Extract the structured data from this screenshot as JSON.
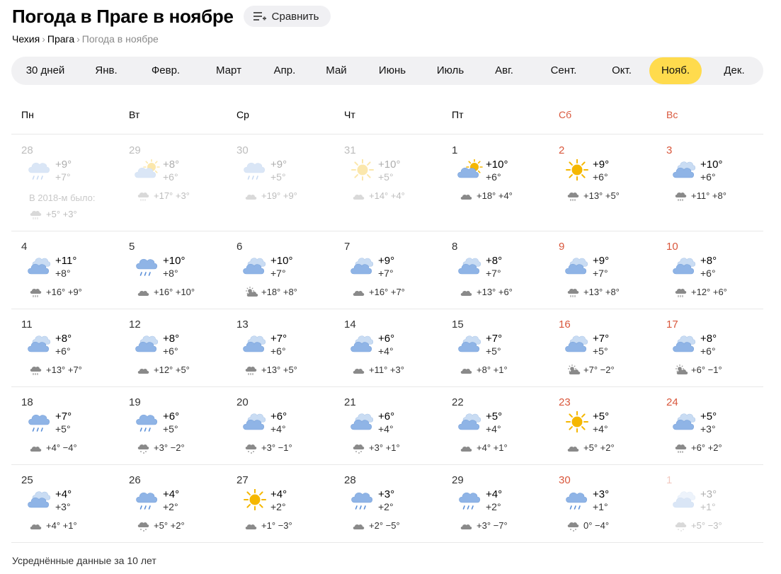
{
  "header": {
    "title": "Погода в Праге в ноябре",
    "compare_label": "Сравнить"
  },
  "breadcrumb": {
    "country": "Чехия",
    "city": "Прага",
    "current": "Погода в ноябре",
    "sep": "›"
  },
  "months": [
    {
      "label": "30 дней",
      "active": false
    },
    {
      "label": "Янв.",
      "active": false
    },
    {
      "label": "Февр.",
      "active": false
    },
    {
      "label": "Март",
      "active": false
    },
    {
      "label": "Апр.",
      "active": false
    },
    {
      "label": "Май",
      "active": false
    },
    {
      "label": "Июнь",
      "active": false
    },
    {
      "label": "Июль",
      "active": false
    },
    {
      "label": "Авг.",
      "active": false
    },
    {
      "label": "Сент.",
      "active": false
    },
    {
      "label": "Окт.",
      "active": false
    },
    {
      "label": "Нояб.",
      "active": true
    },
    {
      "label": "Дек.",
      "active": false
    }
  ],
  "weekdays": [
    {
      "label": "Пн",
      "weekend": false
    },
    {
      "label": "Вт",
      "weekend": false
    },
    {
      "label": "Ср",
      "weekend": false
    },
    {
      "label": "Чт",
      "weekend": false
    },
    {
      "label": "Пт",
      "weekend": false
    },
    {
      "label": "Сб",
      "weekend": true
    },
    {
      "label": "Вс",
      "weekend": true
    }
  ],
  "colors": {
    "accent": "#ffdb4d",
    "weekend": "#d9573c",
    "cloud": "#8fb4e6",
    "sun": "#f5b700",
    "rain": "#5a8fd8",
    "hist_cloud": "#8a8a8a"
  },
  "weeks": [
    [
      {
        "day": "28",
        "weekend": false,
        "faded": true,
        "icon": "rain-cloud-icon",
        "max": "+9°",
        "min": "+7°",
        "note": "В 2018-м было:",
        "hist_icon": "hist-rain-icon",
        "hist": "+5° +3°"
      },
      {
        "day": "29",
        "weekend": false,
        "faded": true,
        "icon": "sun-cloud-icon",
        "max": "+8°",
        "min": "+6°",
        "hist_icon": "hist-rain-icon",
        "hist": "+17° +3°"
      },
      {
        "day": "30",
        "weekend": false,
        "faded": true,
        "icon": "rain-cloud-icon",
        "max": "+9°",
        "min": "+5°",
        "hist_icon": "hist-cloud-icon",
        "hist": "+19° +9°"
      },
      {
        "day": "31",
        "weekend": false,
        "faded": true,
        "icon": "sun-icon",
        "max": "+10°",
        "min": "+5°",
        "hist_icon": "hist-cloud-icon",
        "hist": "+14° +4°"
      },
      {
        "day": "1",
        "weekend": false,
        "faded": false,
        "icon": "sun-cloud-icon",
        "max": "+10°",
        "min": "+6°",
        "hist_icon": "hist-cloud-icon",
        "hist": "+18° +4°"
      },
      {
        "day": "2",
        "weekend": true,
        "faded": false,
        "icon": "sun-icon",
        "max": "+9°",
        "min": "+6°",
        "hist_icon": "hist-rain-icon",
        "hist": "+13° +5°"
      },
      {
        "day": "3",
        "weekend": true,
        "faded": false,
        "icon": "cloud-icon",
        "max": "+10°",
        "min": "+6°",
        "hist_icon": "hist-rain-icon",
        "hist": "+11° +8°"
      }
    ],
    [
      {
        "day": "4",
        "weekend": false,
        "faded": false,
        "icon": "cloud-icon",
        "max": "+11°",
        "min": "+8°",
        "hist_icon": "hist-rain-icon",
        "hist": "+16° +9°"
      },
      {
        "day": "5",
        "weekend": false,
        "faded": false,
        "icon": "rain-cloud-icon",
        "max": "+10°",
        "min": "+8°",
        "hist_icon": "hist-cloud-icon",
        "hist": "+16° +10°"
      },
      {
        "day": "6",
        "weekend": false,
        "faded": false,
        "icon": "cloud-icon",
        "max": "+10°",
        "min": "+7°",
        "hist_icon": "hist-sun-cloud-icon",
        "hist": "+18° +8°"
      },
      {
        "day": "7",
        "weekend": false,
        "faded": false,
        "icon": "cloud-icon",
        "max": "+9°",
        "min": "+7°",
        "hist_icon": "hist-cloud-icon",
        "hist": "+16° +7°"
      },
      {
        "day": "8",
        "weekend": false,
        "faded": false,
        "icon": "cloud-icon",
        "max": "+8°",
        "min": "+7°",
        "hist_icon": "hist-cloud-icon",
        "hist": "+13° +6°"
      },
      {
        "day": "9",
        "weekend": true,
        "faded": false,
        "icon": "cloud-icon",
        "max": "+9°",
        "min": "+7°",
        "hist_icon": "hist-rain-icon",
        "hist": "+13° +8°"
      },
      {
        "day": "10",
        "weekend": true,
        "faded": false,
        "icon": "cloud-icon",
        "max": "+8°",
        "min": "+6°",
        "hist_icon": "hist-rain-icon",
        "hist": "+12° +6°"
      }
    ],
    [
      {
        "day": "11",
        "weekend": false,
        "faded": false,
        "icon": "cloud-icon",
        "max": "+8°",
        "min": "+6°",
        "hist_icon": "hist-rain-icon",
        "hist": "+13° +7°"
      },
      {
        "day": "12",
        "weekend": false,
        "faded": false,
        "icon": "cloud-icon",
        "max": "+8°",
        "min": "+6°",
        "hist_icon": "hist-cloud-icon",
        "hist": "+12° +5°"
      },
      {
        "day": "13",
        "weekend": false,
        "faded": false,
        "icon": "cloud-icon",
        "max": "+7°",
        "min": "+6°",
        "hist_icon": "hist-rain-icon",
        "hist": "+13° +5°"
      },
      {
        "day": "14",
        "weekend": false,
        "faded": false,
        "icon": "cloud-icon",
        "max": "+6°",
        "min": "+4°",
        "hist_icon": "hist-cloud-icon",
        "hist": "+11° +3°"
      },
      {
        "day": "15",
        "weekend": false,
        "faded": false,
        "icon": "cloud-icon",
        "max": "+7°",
        "min": "+5°",
        "hist_icon": "hist-cloud-icon",
        "hist": "+8° +1°"
      },
      {
        "day": "16",
        "weekend": true,
        "faded": false,
        "icon": "cloud-icon",
        "max": "+7°",
        "min": "+5°",
        "hist_icon": "hist-sun-cloud-icon",
        "hist": "+7° −2°"
      },
      {
        "day": "17",
        "weekend": true,
        "faded": false,
        "icon": "cloud-icon",
        "max": "+8°",
        "min": "+6°",
        "hist_icon": "hist-sun-cloud-icon",
        "hist": "+6° −1°"
      }
    ],
    [
      {
        "day": "18",
        "weekend": false,
        "faded": false,
        "icon": "rain-cloud-icon",
        "max": "+7°",
        "min": "+5°",
        "hist_icon": "hist-cloud-icon",
        "hist": "+4° −4°"
      },
      {
        "day": "19",
        "weekend": false,
        "faded": false,
        "icon": "rain-cloud-icon",
        "max": "+6°",
        "min": "+5°",
        "hist_icon": "hist-snow-icon",
        "hist": "+3° −2°"
      },
      {
        "day": "20",
        "weekend": false,
        "faded": false,
        "icon": "cloud-icon",
        "max": "+6°",
        "min": "+4°",
        "hist_icon": "hist-snow-icon",
        "hist": "+3° −1°"
      },
      {
        "day": "21",
        "weekend": false,
        "faded": false,
        "icon": "cloud-icon",
        "max": "+6°",
        "min": "+4°",
        "hist_icon": "hist-snow-icon",
        "hist": "+3° +1°"
      },
      {
        "day": "22",
        "weekend": false,
        "faded": false,
        "icon": "cloud-icon",
        "max": "+5°",
        "min": "+4°",
        "hist_icon": "hist-cloud-icon",
        "hist": "+4° +1°"
      },
      {
        "day": "23",
        "weekend": true,
        "faded": false,
        "icon": "sun-icon",
        "max": "+5°",
        "min": "+4°",
        "hist_icon": "hist-cloud-icon",
        "hist": "+5° +2°"
      },
      {
        "day": "24",
        "weekend": true,
        "faded": false,
        "icon": "cloud-icon",
        "max": "+5°",
        "min": "+3°",
        "hist_icon": "hist-rain-icon",
        "hist": "+6° +2°"
      }
    ],
    [
      {
        "day": "25",
        "weekend": false,
        "faded": false,
        "icon": "cloud-icon",
        "max": "+4°",
        "min": "+3°",
        "hist_icon": "hist-cloud-icon",
        "hist": "+4° +1°"
      },
      {
        "day": "26",
        "weekend": false,
        "faded": false,
        "icon": "rain-cloud-icon",
        "max": "+4°",
        "min": "+2°",
        "hist_icon": "hist-snow-icon",
        "hist": "+5° +2°"
      },
      {
        "day": "27",
        "weekend": false,
        "faded": false,
        "icon": "sun-icon",
        "max": "+4°",
        "min": "+2°",
        "hist_icon": "hist-cloud-icon",
        "hist": "+1° −3°"
      },
      {
        "day": "28",
        "weekend": false,
        "faded": false,
        "icon": "rain-cloud-icon",
        "max": "+3°",
        "min": "+2°",
        "hist_icon": "hist-cloud-icon",
        "hist": "+2° −5°"
      },
      {
        "day": "29",
        "weekend": false,
        "faded": false,
        "icon": "rain-cloud-icon",
        "max": "+4°",
        "min": "+2°",
        "hist_icon": "hist-cloud-icon",
        "hist": "+3° −7°"
      },
      {
        "day": "30",
        "weekend": true,
        "faded": false,
        "icon": "rain-cloud-icon",
        "max": "+3°",
        "min": "+1°",
        "hist_icon": "hist-snow-icon",
        "hist": "0° −4°"
      },
      {
        "day": "1",
        "weekend": true,
        "faded": true,
        "icon": "cloud-icon",
        "max": "+3°",
        "min": "+1°",
        "hist_icon": "hist-snow-icon",
        "hist": "+5° −3°"
      }
    ]
  ],
  "footer": "Усреднённые данные за 10 лет"
}
